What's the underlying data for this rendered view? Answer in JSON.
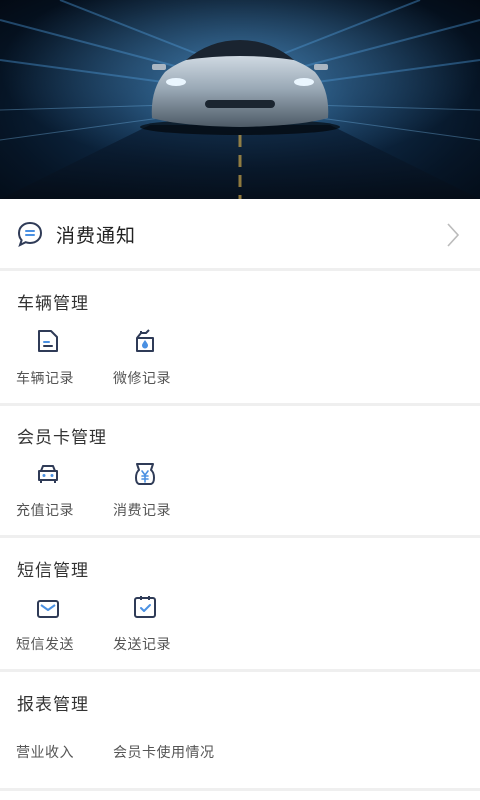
{
  "notice": {
    "label": "消费通知"
  },
  "sections": [
    {
      "title": "车辆管理",
      "items": [
        {
          "label": "车辆记录",
          "icon": "document-icon"
        },
        {
          "label": "微修记录",
          "icon": "oil-can-icon"
        }
      ]
    },
    {
      "title": "会员卡管理",
      "items": [
        {
          "label": "充值记录",
          "icon": "car-front-icon"
        },
        {
          "label": "消费记录",
          "icon": "yen-bag-icon"
        }
      ]
    },
    {
      "title": "短信管理",
      "items": [
        {
          "label": "短信发送",
          "icon": "envelope-icon"
        },
        {
          "label": "发送记录",
          "icon": "calendar-check-icon"
        }
      ]
    },
    {
      "title": "报表管理",
      "items": [
        {
          "label": "营业收入"
        },
        {
          "label": "会员卡使用情况"
        }
      ]
    }
  ],
  "colors": {
    "icon_stroke": "#2f3b57",
    "icon_accent": "#4a90e2",
    "divider": "#efefef"
  }
}
